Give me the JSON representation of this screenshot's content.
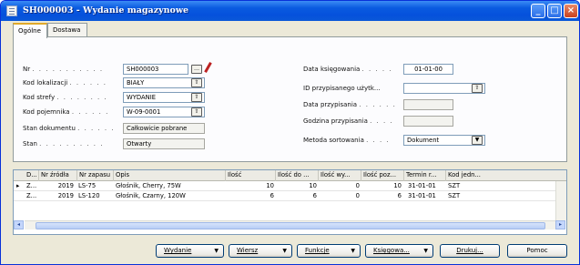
{
  "window": {
    "title": "SH000003 - Wydanie magazynowe",
    "controls": {
      "minimize": "_",
      "maximize": "□",
      "close": "×"
    }
  },
  "tabs": [
    {
      "label": "Ogólne",
      "active": true
    },
    {
      "label": "Dostawa",
      "active": false
    }
  ],
  "left_fields": {
    "nr": {
      "label": "Nr",
      "value": "SH000003"
    },
    "kod_lokalizacji": {
      "label": "Kod lokalizacji",
      "value": "BIAŁY"
    },
    "kod_strefy": {
      "label": "Kod strefy",
      "value": "WYDANIE"
    },
    "kod_pojemnika": {
      "label": "Kod pojemnika",
      "value": "W-09-0001"
    },
    "stan_dokumentu": {
      "label": "Stan dokumentu",
      "value": "Całkowicie pobrane"
    },
    "stan": {
      "label": "Stan",
      "value": "Otwarty"
    }
  },
  "right_fields": {
    "data_ksiegowania": {
      "label": "Data księgowania",
      "value": "01-01-00"
    },
    "id_przypisanego": {
      "label": "ID przypisanego użytk...",
      "value": ""
    },
    "data_przypisania": {
      "label": "Data przypisania",
      "value": ""
    },
    "godzina_przypisania": {
      "label": "Godzina przypisania",
      "value": ""
    },
    "metoda_sortowania": {
      "label": "Metoda sortowania",
      "value": "Dokument"
    }
  },
  "dots": {
    "nr": ". . . . . . . . . . .",
    "kod_lokalizacji": ". . . . . .",
    "kod_strefy": ". . . . . . . .",
    "kod_pojemnika": ". . . . . .",
    "stan_dokumentu": ". . . . . .",
    "stan": ". . . . . . . . . .",
    "data_ksiegowania": ". . . . .",
    "data_przypisania": ". . . . . .",
    "godzina_przypisania": ". . . .",
    "metoda_sortowania": ". . . ."
  },
  "grid": {
    "columns": [
      "D...",
      "Nr źródła",
      "Nr zapasu",
      "Opis",
      "Ilość",
      "Ilość do ...",
      "Ilość wy...",
      "Ilość poz...",
      "Termin r...",
      "Kod jedn..."
    ],
    "rows": [
      {
        "selected": true,
        "cells": [
          "Z...",
          "2019",
          "LS-75",
          "Głośnik, Cherry, 75W",
          "10",
          "10",
          "0",
          "10",
          "31-01-01",
          "SZT"
        ]
      },
      {
        "selected": false,
        "cells": [
          "Z...",
          "2019",
          "LS-120",
          "Głośnik, Czarny, 120W",
          "6",
          "6",
          "0",
          "6",
          "31-01-01",
          "SZT"
        ]
      }
    ],
    "row_marker": "▸"
  },
  "buttons": [
    {
      "label": "Wydanie",
      "dropdown": true
    },
    {
      "label": "Wiersz",
      "dropdown": true
    },
    {
      "label": "Funkcje",
      "dropdown": true
    },
    {
      "label": "Księgowa...",
      "dropdown": true
    },
    {
      "label": "Drukuj...",
      "dropdown": false
    },
    {
      "label": "Pomoc",
      "dropdown": false
    }
  ],
  "glyphs": {
    "dropdown": "▼",
    "lookup": "⇧",
    "assist": "…"
  },
  "colors": {
    "titlebar": "#0a5be0",
    "window_bg": "#ece9d8",
    "tab_highlight": "#e0a92a"
  }
}
